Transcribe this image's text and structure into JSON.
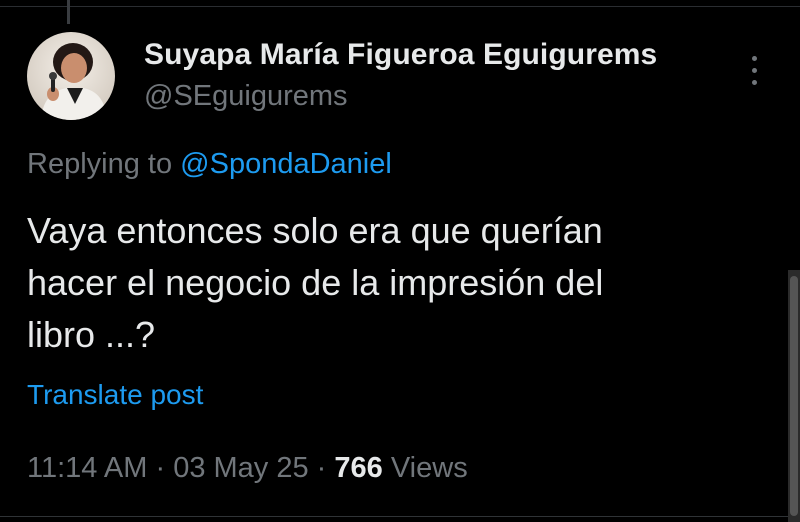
{
  "tweet": {
    "author": {
      "display_name": "Suyapa María Figueroa Eguigurems",
      "handle": "@SEguigurems",
      "avatar_icon": "profile-photo-woman-with-microphone"
    },
    "reply_context": {
      "prefix": "Replying to",
      "mention": "@SpondaDaniel"
    },
    "text_lines": [
      "Vaya entonces solo era que querían",
      "hacer el negocio de la impresión del",
      "libro ...?"
    ],
    "translate_label": "Translate post",
    "meta": {
      "time": "11:14 AM",
      "separator": "·",
      "date": "03 May 25",
      "views_count": "766",
      "views_label": "Views"
    }
  },
  "icons": {
    "more": "more-vertical-icon"
  },
  "colors": {
    "background": "#000000",
    "primary_text": "#e7e9ea",
    "secondary_text": "#71767b",
    "link": "#1d9bf0"
  }
}
